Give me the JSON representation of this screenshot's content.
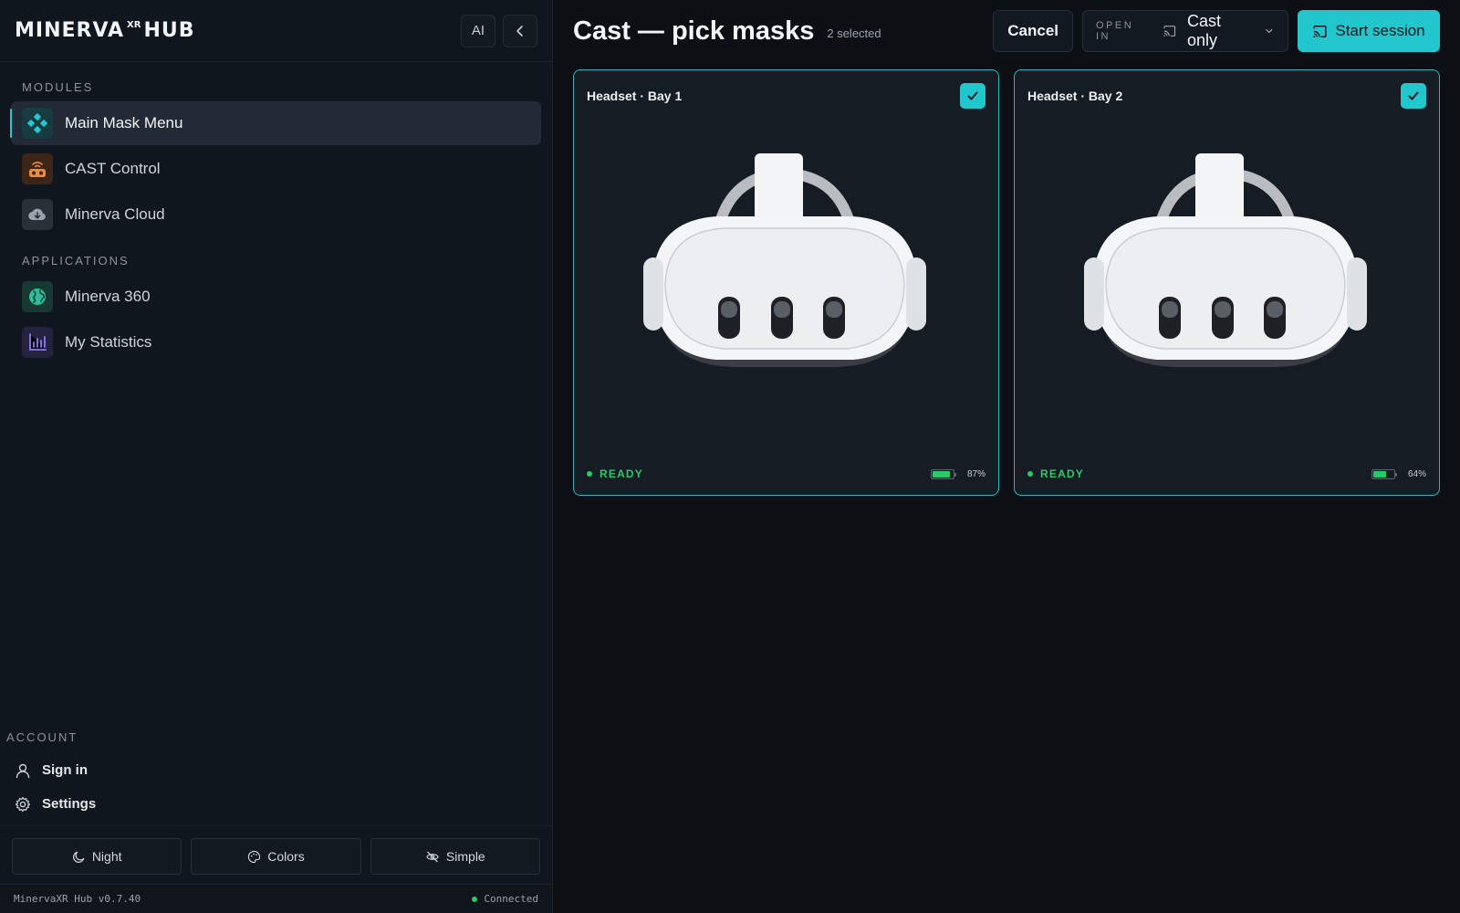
{
  "sidebar": {
    "logo": {
      "main": "MINERVA",
      "sup": "XR",
      "tail": "HUB"
    },
    "header_buttons": {
      "ai_label": "AI"
    },
    "sections": {
      "modules": "MODULES",
      "applications": "APPLICATIONS",
      "account": "ACCOUNT"
    },
    "modules": [
      {
        "label": "Main Mask Menu",
        "icon": "mask-menu-icon",
        "color": "#21c9d0",
        "active": true
      },
      {
        "label": "CAST Control",
        "icon": "cast-vr-icon",
        "color": "#f08a3c"
      },
      {
        "label": "Minerva Cloud",
        "icon": "cloud-download-icon",
        "color": "#9aa2ab"
      }
    ],
    "applications": [
      {
        "label": "Minerva 360",
        "icon": "globe-icon",
        "color": "#2bbf9a"
      },
      {
        "label": "My Statistics",
        "icon": "bar-chart-icon",
        "color": "#8a7cf0"
      }
    ],
    "account": [
      {
        "label": "Sign in",
        "icon": "user-icon"
      },
      {
        "label": "Settings",
        "icon": "gear-icon"
      }
    ],
    "bottom_buttons": [
      {
        "label": "Night",
        "icon": "moon-icon"
      },
      {
        "label": "Colors",
        "icon": "palette-icon"
      },
      {
        "label": "Simple",
        "icon": "eye-off-icon"
      }
    ],
    "status": {
      "version": "MinervaXR Hub v0.7.40",
      "connection": "Connected"
    }
  },
  "main": {
    "title": "Cast — pick masks",
    "selected_count": "2 selected",
    "cancel_label": "Cancel",
    "open_in": {
      "label": "OPEN IN",
      "value": "Cast only"
    },
    "start_label": "Start session",
    "accent": "#22c6cd",
    "cards": [
      {
        "title": "Headset · Bay 1",
        "status": "READY",
        "battery": "87%",
        "battery_level": 0.87,
        "selected": true
      },
      {
        "title": "Headset · Bay 2",
        "status": "READY",
        "battery": "64%",
        "battery_level": 0.64,
        "selected": true
      }
    ]
  }
}
